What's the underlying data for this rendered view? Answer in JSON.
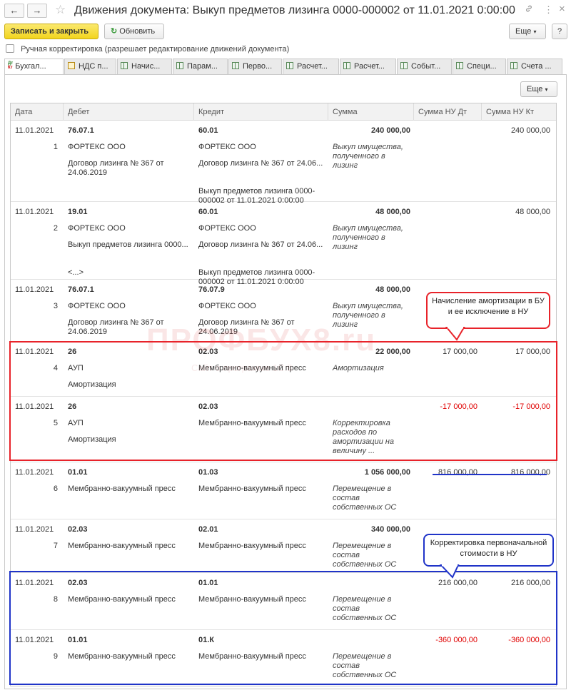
{
  "window": {
    "title": "Движения документа: Выкуп предметов лизинга 0000-000002 от 11.01.2021 0:00:00",
    "back_icon": "←",
    "forward_icon": "→",
    "star_icon": "☆",
    "link_icon": "🔗",
    "menu_icon": "⋮",
    "close_icon": "×"
  },
  "toolbar": {
    "save_close_label": "Записать и закрыть",
    "refresh_label": "Обновить",
    "more_label": "Еще",
    "help_label": "?"
  },
  "manual_correction": {
    "label": "Ручная корректировка (разрешает редактирование движений документа)",
    "checked": false
  },
  "tabs": [
    {
      "label": "Бухгал...",
      "active": true
    },
    {
      "label": "НДС п...",
      "active": false
    },
    {
      "label": "Начис...",
      "active": false
    },
    {
      "label": "Парам...",
      "active": false
    },
    {
      "label": "Перво...",
      "active": false
    },
    {
      "label": "Расчет...",
      "active": false
    },
    {
      "label": "Расчет...",
      "active": false
    },
    {
      "label": "Событ...",
      "active": false
    },
    {
      "label": "Специ...",
      "active": false
    },
    {
      "label": "Счета ...",
      "active": false
    }
  ],
  "tab_badge": {
    "top": "Дт",
    "bottom": "Кт"
  },
  "panel_more_label": "Еще",
  "columns": [
    "Дата",
    "Дебет",
    "Кредит",
    "Сумма",
    "Сумма НУ Дт",
    "Сумма НУ Кт"
  ],
  "rows": [
    {
      "date": "11.01.2021",
      "no": "1",
      "debit": [
        "76.07.1",
        "ФОРТЕКС ООО",
        "Договор лизинга № 367 от 24.06.2019"
      ],
      "credit": [
        "60.01",
        "ФОРТЕКС ООО",
        "Договор лизинга № 367 от 24.06...",
        "Выкуп предметов лизинга 0000-000002 от 11.01.2021 0:00:00"
      ],
      "sum": "240 000,00",
      "content": "Выкуп имущества, полученного в лизинг",
      "nu_dt": "",
      "nu_kt": "240 000,00"
    },
    {
      "date": "11.01.2021",
      "no": "2",
      "debit": [
        "19.01",
        "ФОРТЕКС ООО",
        "Выкуп предметов лизинга 0000...",
        "<...>"
      ],
      "credit": [
        "60.01",
        "ФОРТЕКС ООО",
        "Договор лизинга № 367 от 24.06...",
        "Выкуп предметов лизинга 0000-000002 от 11.01.2021 0:00:00"
      ],
      "sum": "48 000,00",
      "content": "Выкуп имущества, полученного в лизинг",
      "nu_dt": "",
      "nu_kt": "48 000,00"
    },
    {
      "date": "11.01.2021",
      "no": "3",
      "debit": [
        "76.07.1",
        "ФОРТЕКС ООО",
        "Договор лизинга № 367 от 24.06.2019"
      ],
      "credit": [
        "76.07.9",
        "ФОРТЕКС ООО",
        "Договор лизинга № 367 от 24.06.2019"
      ],
      "sum": "48 000,00",
      "content": "Выкуп имущества, полученного в лизинг",
      "nu_dt": "",
      "nu_kt": ""
    },
    {
      "date": "11.01.2021",
      "no": "4",
      "debit": [
        "26",
        "АУП",
        "Амортизация"
      ],
      "credit": [
        "02.03",
        "Мембранно-вакуумный пресс"
      ],
      "sum": "22 000,00",
      "content": "Амортизация",
      "nu_dt": "17 000,00",
      "nu_kt": "17 000,00"
    },
    {
      "date": "11.01.2021",
      "no": "5",
      "debit": [
        "26",
        "АУП",
        "Амортизация"
      ],
      "credit": [
        "02.03",
        "Мембранно-вакуумный пресс"
      ],
      "sum": "",
      "content": "Корректировка расходов по амортизации на величину ...",
      "nu_dt": "-17 000,00",
      "nu_kt": "-17 000,00"
    },
    {
      "date": "11.01.2021",
      "no": "6",
      "debit": [
        "01.01",
        "Мембранно-вакуумный пресс"
      ],
      "credit": [
        "01.03",
        "Мембранно-вакуумный пресс"
      ],
      "sum": "1 056 000,00",
      "content": "Перемещение в состав собственных ОС",
      "nu_dt": "816 000,00",
      "nu_kt": "816 000,00"
    },
    {
      "date": "11.01.2021",
      "no": "7",
      "debit": [
        "02.03",
        "Мембранно-вакуумный пресс"
      ],
      "credit": [
        "02.01",
        "Мембранно-вакуумный пресс"
      ],
      "sum": "340 000,00",
      "content": "Перемещение в состав собственных ОС",
      "nu_dt": "",
      "nu_kt": ""
    },
    {
      "date": "11.01.2021",
      "no": "8",
      "debit": [
        "02.03",
        "Мембранно-вакуумный пресс"
      ],
      "credit": [
        "01.01",
        "Мембранно-вакуумный пресс"
      ],
      "sum": "",
      "content": "Перемещение в состав собственных ОС",
      "nu_dt": "216 000,00",
      "nu_kt": "216 000,00"
    },
    {
      "date": "11.01.2021",
      "no": "9",
      "debit": [
        "01.01",
        "Мембранно-вакуумный пресс"
      ],
      "credit": [
        "01.К",
        "Мембранно-вакуумный пресс"
      ],
      "sum": "",
      "content": "Перемещение в состав собственных ОС",
      "nu_dt": "-360 000,00",
      "nu_kt": "-360 000,00"
    }
  ],
  "annotations": {
    "callout_red": "Начисление амортизации в БУ и ее исключение в НУ",
    "callout_blue": "Корректировка первоначальной стоимости в НУ"
  },
  "watermark": {
    "main": "ПРОФБУХ8.ru",
    "sub": "Сайт о программе 1С:8"
  },
  "colors": {
    "accent_yellow": "#f2d41e",
    "annotation_red": "#e8232a",
    "annotation_blue": "#2034c8",
    "negative": "#e00000"
  }
}
